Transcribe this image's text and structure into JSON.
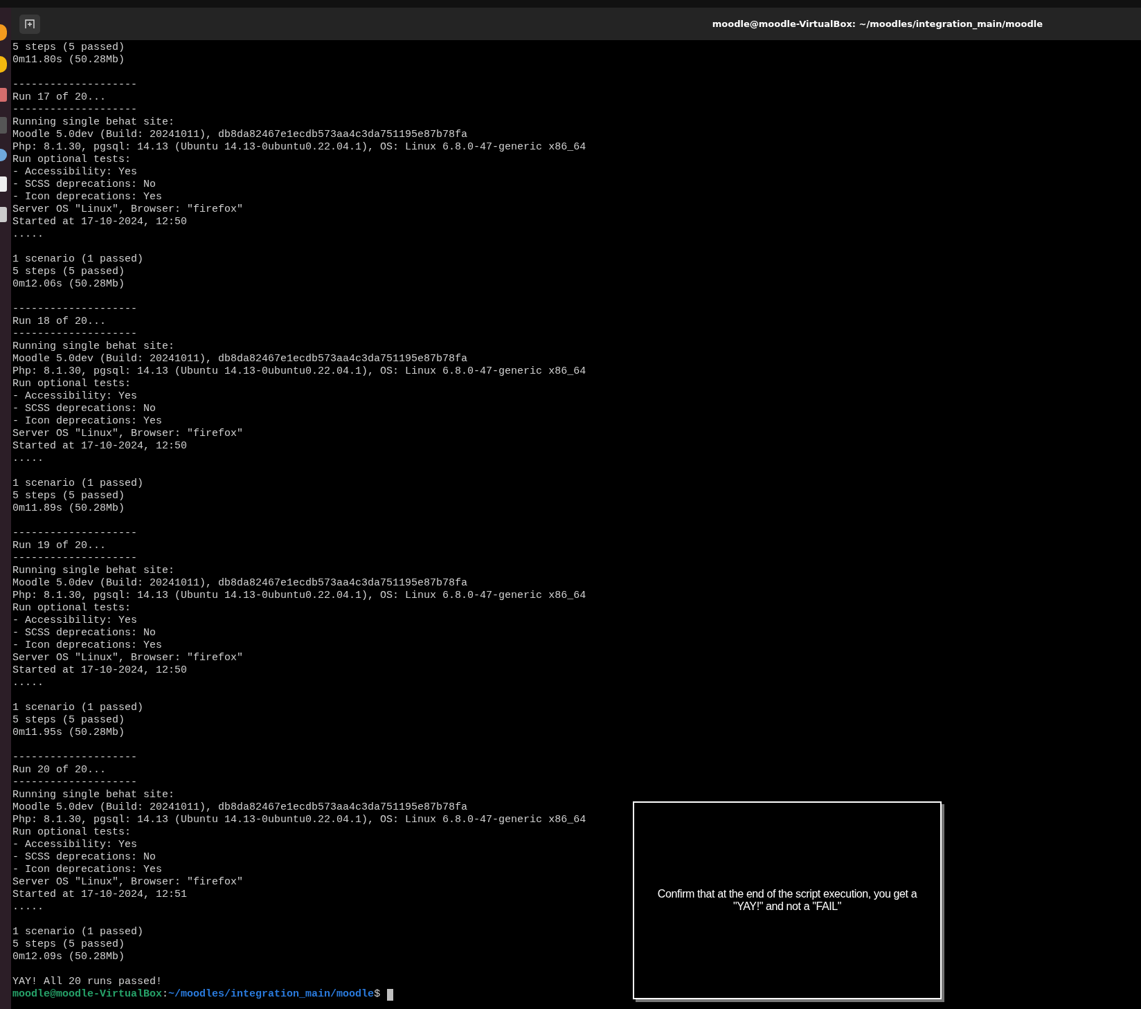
{
  "window": {
    "title": "moodle@moodle-VirtualBox: ~/moodles/integration_main/moodle"
  },
  "terminal": {
    "blocks": [
      {
        "lines": [
          "5 steps (5 passed)",
          "0m11.80s (50.28Mb)"
        ]
      },
      {
        "lines": [
          "--------------------",
          "Run 17 of 20...",
          "--------------------",
          "Running single behat site:",
          "Moodle 5.0dev (Build: 20241011), db8da82467e1ecdb573aa4c3da751195e87b78fa",
          "Php: 8.1.30, pgsql: 14.13 (Ubuntu 14.13-0ubuntu0.22.04.1), OS: Linux 6.8.0-47-generic x86_64",
          "Run optional tests:",
          "- Accessibility: Yes",
          "- SCSS deprecations: No",
          "- Icon deprecations: Yes",
          "Server OS \"Linux\", Browser: \"firefox\"",
          "Started at 17-10-2024, 12:50",
          "....."
        ]
      },
      {
        "lines": [
          "1 scenario (1 passed)",
          "5 steps (5 passed)",
          "0m12.06s (50.28Mb)"
        ]
      },
      {
        "lines": [
          "--------------------",
          "Run 18 of 20...",
          "--------------------",
          "Running single behat site:",
          "Moodle 5.0dev (Build: 20241011), db8da82467e1ecdb573aa4c3da751195e87b78fa",
          "Php: 8.1.30, pgsql: 14.13 (Ubuntu 14.13-0ubuntu0.22.04.1), OS: Linux 6.8.0-47-generic x86_64",
          "Run optional tests:",
          "- Accessibility: Yes",
          "- SCSS deprecations: No",
          "- Icon deprecations: Yes",
          "Server OS \"Linux\", Browser: \"firefox\"",
          "Started at 17-10-2024, 12:50",
          "....."
        ]
      },
      {
        "lines": [
          "1 scenario (1 passed)",
          "5 steps (5 passed)",
          "0m11.89s (50.28Mb)"
        ]
      },
      {
        "lines": [
          "--------------------",
          "Run 19 of 20...",
          "--------------------",
          "Running single behat site:",
          "Moodle 5.0dev (Build: 20241011), db8da82467e1ecdb573aa4c3da751195e87b78fa",
          "Php: 8.1.30, pgsql: 14.13 (Ubuntu 14.13-0ubuntu0.22.04.1), OS: Linux 6.8.0-47-generic x86_64",
          "Run optional tests:",
          "- Accessibility: Yes",
          "- SCSS deprecations: No",
          "- Icon deprecations: Yes",
          "Server OS \"Linux\", Browser: \"firefox\"",
          "Started at 17-10-2024, 12:50",
          "....."
        ]
      },
      {
        "lines": [
          "1 scenario (1 passed)",
          "5 steps (5 passed)",
          "0m11.95s (50.28Mb)"
        ]
      },
      {
        "lines": [
          "--------------------",
          "Run 20 of 20...",
          "--------------------",
          "Running single behat site:",
          "Moodle 5.0dev (Build: 20241011), db8da82467e1ecdb573aa4c3da751195e87b78fa",
          "Php: 8.1.30, pgsql: 14.13 (Ubuntu 14.13-0ubuntu0.22.04.1), OS: Linux 6.8.0-47-generic x86_64",
          "Run optional tests:",
          "- Accessibility: Yes",
          "- SCSS deprecations: No",
          "- Icon deprecations: Yes",
          "Server OS \"Linux\", Browser: \"firefox\"",
          "Started at 17-10-2024, 12:51",
          "....."
        ]
      },
      {
        "lines": [
          "1 scenario (1 passed)",
          "5 steps (5 passed)",
          "0m12.09s (50.28Mb)"
        ]
      },
      {
        "lines": [
          "YAY! All 20 runs passed!"
        ]
      }
    ],
    "prompt": {
      "user_host": "moodle@moodle-VirtualBox",
      "separator": ":",
      "path": "~/moodles/integration_main/moodle",
      "symbol": "$"
    }
  },
  "annotation": {
    "text": "Confirm that at the end of the script execution, you get a \"YAY!\" and not a \"FAIL\""
  }
}
